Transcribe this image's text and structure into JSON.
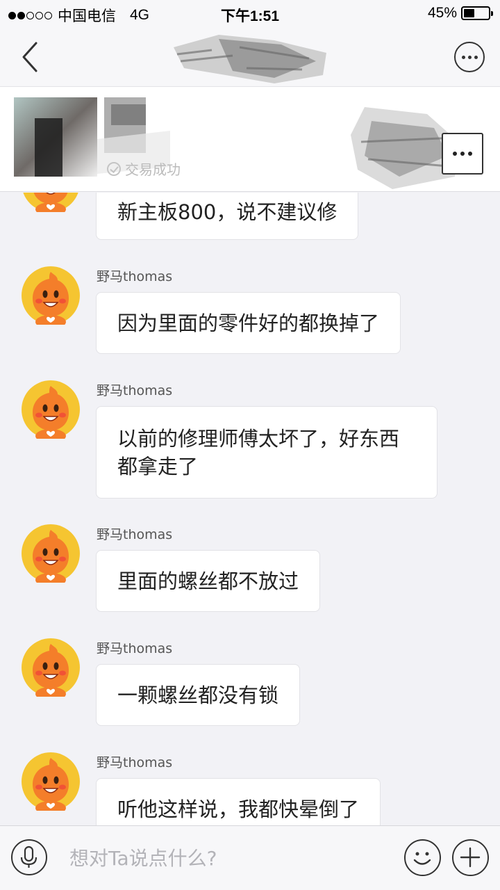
{
  "status_bar": {
    "carrier": "中国电信",
    "network": "4G",
    "time": "下午1:51",
    "battery_text": "45%",
    "battery_level": 0.45,
    "signal_bars_filled": 2,
    "signal_bars_total": 5
  },
  "nav": {
    "back_icon": "chevron-left-icon",
    "more_icon": "ellipsis-circle-icon"
  },
  "order_card": {
    "status_text": "交易成功",
    "more_icon": "ellipsis-icon"
  },
  "chat": {
    "messages": [
      {
        "sender": "",
        "text": "新主板800，说不建议修"
      },
      {
        "sender": "野马thomas",
        "text": "因为里面的零件好的都换掉了"
      },
      {
        "sender": "野马thomas",
        "text": "以前的修理师傅太坏了，好东西都拿走了"
      },
      {
        "sender": "野马thomas",
        "text": "里面的螺丝都不放过"
      },
      {
        "sender": "野马thomas",
        "text": "一颗螺丝都没有锁"
      },
      {
        "sender": "野马thomas",
        "text": "听他这样说，我都快晕倒了"
      }
    ]
  },
  "input_bar": {
    "placeholder": "想对Ta说点什么?",
    "voice_icon": "microphone-icon",
    "emoji_icon": "smiley-icon",
    "add_icon": "plus-icon"
  },
  "colors": {
    "background": "#f2f2f6",
    "bubble": "#ffffff",
    "avatar_ring": "#f5c531",
    "avatar_body": "#f47e2a"
  }
}
